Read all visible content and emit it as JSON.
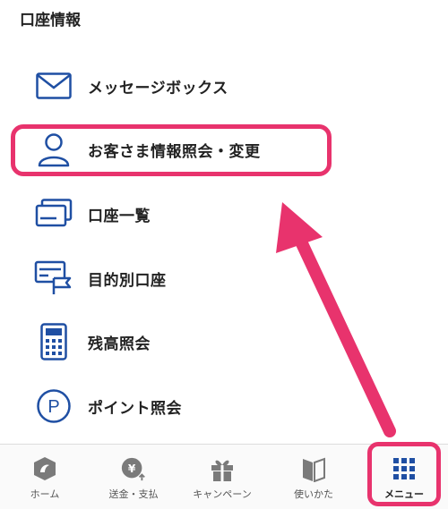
{
  "header": {
    "title": "口座情報"
  },
  "menu": {
    "items": [
      {
        "label": "メッセージボックス",
        "icon": "envelope-icon"
      },
      {
        "label": "お客さま情報照会・変更",
        "icon": "person-icon"
      },
      {
        "label": "口座一覧",
        "icon": "cards-icon"
      },
      {
        "label": "目的別口座",
        "icon": "card-flag-icon"
      },
      {
        "label": "残高照会",
        "icon": "calculator-icon"
      },
      {
        "label": "ポイント照会",
        "icon": "point-icon"
      }
    ]
  },
  "bottom_nav": {
    "items": [
      {
        "label": "ホーム",
        "icon": "home-logo-icon"
      },
      {
        "label": "送金・支払",
        "icon": "yen-transfer-icon"
      },
      {
        "label": "キャンペーン",
        "icon": "gift-icon"
      },
      {
        "label": "使いかた",
        "icon": "book-icon"
      },
      {
        "label": "メニュー",
        "icon": "grid-menu-icon",
        "active": true
      }
    ]
  },
  "colors": {
    "accent_blue": "#1f4fa3",
    "highlight_pink": "#e8336d",
    "nav_gray": "#7a7a7a"
  }
}
